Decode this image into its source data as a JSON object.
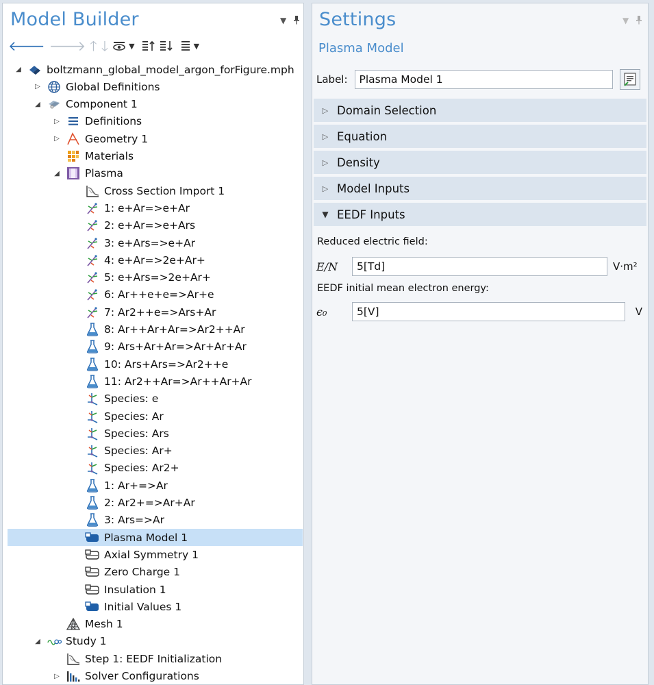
{
  "model_builder": {
    "title": "Model Builder",
    "tree": [
      {
        "label": "boltzmann_global_model_argon_forFigure.mph",
        "indent": 0,
        "expander": "open",
        "icon": "mph-file-icon",
        "name": "tree-root-file"
      },
      {
        "label": "Global Definitions",
        "indent": 1,
        "expander": "closed",
        "icon": "globe-icon",
        "name": "tree-global-definitions"
      },
      {
        "label": "Component 1",
        "indent": 1,
        "expander": "open",
        "icon": "component-icon",
        "name": "tree-component-1"
      },
      {
        "label": "Definitions",
        "indent": 2,
        "expander": "closed",
        "icon": "definitions-icon",
        "name": "tree-definitions"
      },
      {
        "label": "Geometry 1",
        "indent": 2,
        "expander": "closed",
        "icon": "geometry-icon",
        "name": "tree-geometry-1"
      },
      {
        "label": "Materials",
        "indent": 2,
        "expander": "none",
        "icon": "materials-icon",
        "name": "tree-materials"
      },
      {
        "label": "Plasma",
        "indent": 2,
        "expander": "open",
        "icon": "plasma-icon",
        "name": "tree-plasma"
      },
      {
        "label": "Cross Section Import 1",
        "indent": 3,
        "expander": "none",
        "icon": "cross-section-icon",
        "name": "tree-cross-section-import"
      },
      {
        "label": "1: e+Ar=>e+Ar",
        "indent": 3,
        "expander": "none",
        "icon": "electron-reaction-icon",
        "name": "tree-reaction-1"
      },
      {
        "label": "2: e+Ar=>e+Ars",
        "indent": 3,
        "expander": "none",
        "icon": "electron-reaction-icon",
        "name": "tree-reaction-2"
      },
      {
        "label": "3: e+Ars=>e+Ar",
        "indent": 3,
        "expander": "none",
        "icon": "electron-reaction-icon",
        "name": "tree-reaction-3"
      },
      {
        "label": "4: e+Ar=>2e+Ar+",
        "indent": 3,
        "expander": "none",
        "icon": "electron-reaction-icon",
        "name": "tree-reaction-4"
      },
      {
        "label": "5: e+Ars=>2e+Ar+",
        "indent": 3,
        "expander": "none",
        "icon": "electron-reaction-icon",
        "name": "tree-reaction-5"
      },
      {
        "label": "6: Ar++e+e=>Ar+e",
        "indent": 3,
        "expander": "none",
        "icon": "electron-reaction-icon",
        "name": "tree-reaction-6"
      },
      {
        "label": "7: Ar2++e=>Ars+Ar",
        "indent": 3,
        "expander": "none",
        "icon": "electron-reaction-icon",
        "name": "tree-reaction-7"
      },
      {
        "label": "8: Ar++Ar+Ar=>Ar2++Ar",
        "indent": 3,
        "expander": "none",
        "icon": "flask-icon",
        "name": "tree-reaction-8"
      },
      {
        "label": "9: Ars+Ar+Ar=>Ar+Ar+Ar",
        "indent": 3,
        "expander": "none",
        "icon": "flask-icon",
        "name": "tree-reaction-9"
      },
      {
        "label": "10: Ars+Ars=>Ar2++e",
        "indent": 3,
        "expander": "none",
        "icon": "flask-icon",
        "name": "tree-reaction-10"
      },
      {
        "label": "11: Ar2++Ar=>Ar++Ar+Ar",
        "indent": 3,
        "expander": "none",
        "icon": "flask-icon",
        "name": "tree-reaction-11"
      },
      {
        "label": "Species: e",
        "indent": 3,
        "expander": "none",
        "icon": "species-icon",
        "name": "tree-species-e"
      },
      {
        "label": "Species: Ar",
        "indent": 3,
        "expander": "none",
        "icon": "species-icon",
        "name": "tree-species-ar"
      },
      {
        "label": "Species: Ars",
        "indent": 3,
        "expander": "none",
        "icon": "species-icon",
        "name": "tree-species-ars"
      },
      {
        "label": "Species: Ar+",
        "indent": 3,
        "expander": "none",
        "icon": "species-icon",
        "name": "tree-species-ar-plus"
      },
      {
        "label": "Species: Ar2+",
        "indent": 3,
        "expander": "none",
        "icon": "species-icon",
        "name": "tree-species-ar2-plus"
      },
      {
        "label": "1: Ar+=>Ar",
        "indent": 3,
        "expander": "none",
        "icon": "flask-icon",
        "name": "tree-surface-reaction-1"
      },
      {
        "label": "2: Ar2+=>Ar+Ar",
        "indent": 3,
        "expander": "none",
        "icon": "flask-icon",
        "name": "tree-surface-reaction-2"
      },
      {
        "label": "3: Ars=>Ar",
        "indent": 3,
        "expander": "none",
        "icon": "flask-icon",
        "name": "tree-surface-reaction-3"
      },
      {
        "label": "Plasma Model 1",
        "indent": 3,
        "expander": "none",
        "icon": "domain-feature-filled-icon",
        "name": "tree-plasma-model-1",
        "selected": true
      },
      {
        "label": "Axial Symmetry 1",
        "indent": 3,
        "expander": "none",
        "icon": "boundary-feature-icon",
        "name": "tree-axial-symmetry-1"
      },
      {
        "label": "Zero Charge 1",
        "indent": 3,
        "expander": "none",
        "icon": "boundary-feature-icon",
        "name": "tree-zero-charge-1"
      },
      {
        "label": "Insulation 1",
        "indent": 3,
        "expander": "none",
        "icon": "boundary-feature-icon",
        "name": "tree-insulation-1"
      },
      {
        "label": "Initial Values 1",
        "indent": 3,
        "expander": "none",
        "icon": "domain-feature-filled-icon",
        "name": "tree-initial-values-1"
      },
      {
        "label": "Mesh 1",
        "indent": 2,
        "expander": "none",
        "icon": "mesh-icon",
        "name": "tree-mesh-1"
      },
      {
        "label": "Study 1",
        "indent": 1,
        "expander": "open",
        "icon": "study-icon",
        "name": "tree-study-1"
      },
      {
        "label": "Step 1: EEDF Initialization",
        "indent": 2,
        "expander": "none",
        "icon": "study-step-icon",
        "name": "tree-step-1"
      },
      {
        "label": "Solver Configurations",
        "indent": 2,
        "expander": "closed",
        "icon": "solver-icon",
        "name": "tree-solver-configurations"
      }
    ]
  },
  "settings": {
    "title": "Settings",
    "subtitle": "Plasma Model",
    "label_caption": "Label:",
    "label_value": "Plasma Model 1",
    "sections": [
      {
        "label": "Domain Selection",
        "expanded": false
      },
      {
        "label": "Equation",
        "expanded": false
      },
      {
        "label": "Density",
        "expanded": false
      },
      {
        "label": "Model Inputs",
        "expanded": false
      },
      {
        "label": "EEDF Inputs",
        "expanded": true
      }
    ],
    "eedf": {
      "reduced_field_caption": "Reduced electric field:",
      "reduced_field_symbol": "E/N",
      "reduced_field_value": "5[Td]",
      "reduced_field_unit": "V·m²",
      "mean_energy_caption": "EEDF initial mean electron energy:",
      "mean_energy_symbol": "ϵ₀",
      "mean_energy_value": "5[V]",
      "mean_energy_unit": "V"
    }
  },
  "colors": {
    "title_blue": "#4a8dcc",
    "selection": "#c7e0f7",
    "section_header": "#dbe4ee"
  }
}
